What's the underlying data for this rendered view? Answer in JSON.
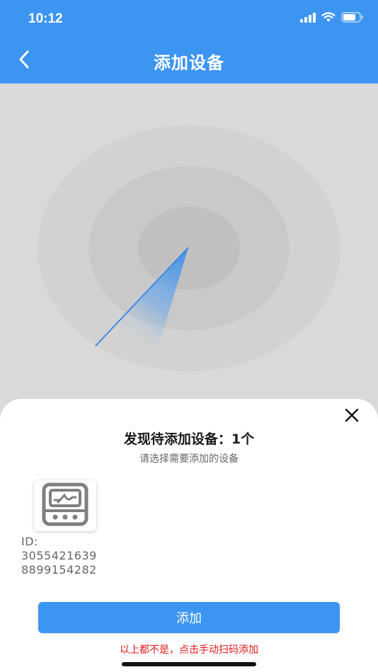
{
  "status_bar": {
    "time": "10:12"
  },
  "nav": {
    "title": "添加设备"
  },
  "sheet": {
    "found_text": "发现待添加设备：1个",
    "hint_text": "请选择需要添加的设备",
    "device": {
      "id_label": "ID:",
      "id_line1": "3055421639",
      "id_line2": "8899154282"
    },
    "add_button_label": "添加",
    "manual_link_text": "以上都不是，点击手动扫码添加"
  },
  "colors": {
    "primary": "#3d95f2",
    "link_red": "#e01818"
  },
  "icons": [
    "chevron-left-icon",
    "signal-icon",
    "wifi-icon",
    "battery-icon",
    "close-icon",
    "device-meter-icon"
  ]
}
